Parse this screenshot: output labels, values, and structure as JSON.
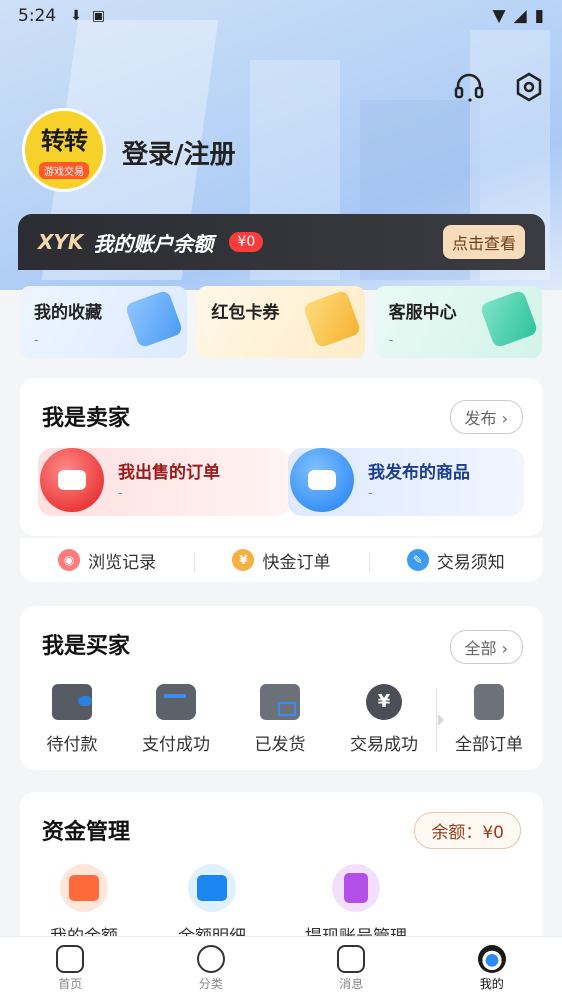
{
  "status_bar": {
    "time": "5:24"
  },
  "profile": {
    "avatar_text": "转转",
    "avatar_sub": "游戏交易",
    "login_label": "登录/注册"
  },
  "balance_bar": {
    "brand": "XYK",
    "title": "我的账户余额",
    "amount": "¥0",
    "view_label": "点击查看"
  },
  "quick_cards": [
    {
      "label": "我的收藏",
      "desc": "-"
    },
    {
      "label": "红包卡券",
      "desc": ""
    },
    {
      "label": "客服中心",
      "desc": "-"
    }
  ],
  "seller": {
    "title": "我是卖家",
    "publish_label": "发布",
    "orders": [
      {
        "label": "我出售的订单",
        "desc": "-"
      },
      {
        "label": "我发布的商品",
        "desc": "-"
      }
    ]
  },
  "links": [
    {
      "label": "浏览记录"
    },
    {
      "label": "快金订单",
      "icon_char": "¥"
    },
    {
      "label": "交易须知"
    }
  ],
  "buyer": {
    "title": "我是买家",
    "all_label": "全部",
    "items": [
      {
        "label": "待付款"
      },
      {
        "label": "支付成功"
      },
      {
        "label": "已发货"
      },
      {
        "label": "交易成功",
        "icon_char": "¥"
      },
      {
        "label": "全部订单"
      }
    ]
  },
  "fund": {
    "title": "资金管理",
    "balance_label": "余额：¥0",
    "items": [
      {
        "label": "我的余额"
      },
      {
        "label": "余额明细"
      },
      {
        "label": "提现账号管理"
      }
    ]
  },
  "tabbar": [
    {
      "label": "首页"
    },
    {
      "label": "分类"
    },
    {
      "label": "消息"
    },
    {
      "label": "我的"
    }
  ]
}
